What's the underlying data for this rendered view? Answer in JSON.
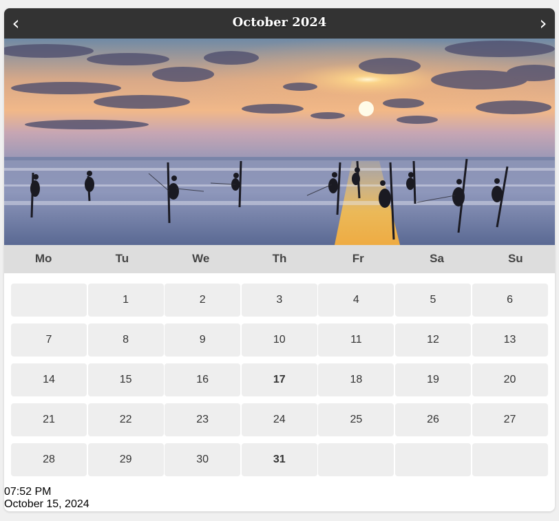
{
  "header": {
    "prev_icon": "‹",
    "next_icon": "›",
    "title": "October 2024"
  },
  "weekdays": [
    "Mo",
    "Tu",
    "We",
    "Th",
    "Fr",
    "Sa",
    "Su"
  ],
  "days": [
    "",
    "1",
    "2",
    "3",
    "4",
    "5",
    "6",
    "7",
    "8",
    "9",
    "10",
    "11",
    "12",
    "13",
    "14",
    "15",
    "16",
    "17",
    "18",
    "19",
    "20",
    "21",
    "22",
    "23",
    "24",
    "25",
    "26",
    "27",
    "28",
    "29",
    "30",
    "31",
    "",
    "",
    ""
  ],
  "bold_days": [
    "17",
    "31"
  ],
  "footer": {
    "time": "07:52 PM",
    "date": "October 15, 2024"
  },
  "colors": {
    "header_bg": "#333333",
    "weekday_bg": "#dddddd",
    "day_bg": "#eeeeee"
  }
}
